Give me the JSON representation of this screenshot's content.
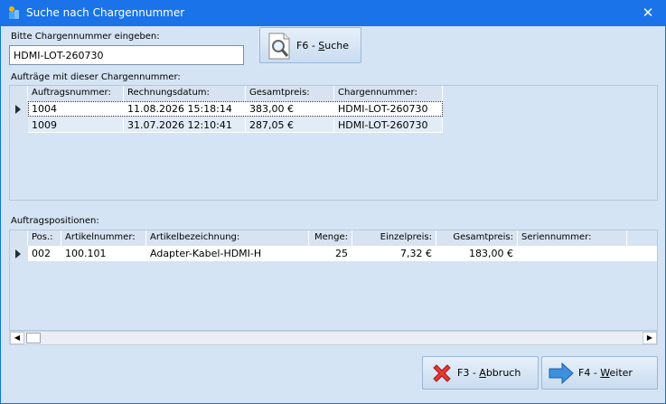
{
  "window": {
    "title": "Suche nach Chargennummer",
    "close_glyph": "✕"
  },
  "search": {
    "label": "Bitte Chargennummer eingeben:",
    "value": "HDMI-LOT-260730",
    "button_prefix": "F6 - ",
    "button_key": "S",
    "button_rest": "uche"
  },
  "orders": {
    "label": "Aufträge mit dieser Chargennummer:",
    "columns": [
      "Auftragsnummer:",
      "Rechnungsdatum:",
      "Gesamtpreis:",
      "Chargennummer:"
    ],
    "rows": [
      [
        "1004",
        "11.08.2026 15:18:14",
        "383,00 €",
        "HDMI-LOT-260730"
      ],
      [
        "1009",
        "31.07.2026 12:10:41",
        "287,05 €",
        "HDMI-LOT-260730"
      ]
    ]
  },
  "positions": {
    "label": "Auftragspositionen:",
    "columns": [
      "Pos.:",
      "Artikelnummer:",
      "Artikelbezeichnung:",
      "Menge:",
      "Einzelpreis:",
      "Gesamtpreis:",
      "Seriennummer:"
    ],
    "rows": [
      [
        "002",
        "100.101",
        "Adapter-Kabel-HDMI-H",
        "25",
        "7,32 €",
        "183,00 €",
        ""
      ]
    ]
  },
  "footer": {
    "cancel_prefix": "F3 - ",
    "cancel_key": "A",
    "cancel_rest": "bbruch",
    "next_prefix": "F4 - ",
    "next_key": "W",
    "next_rest": "eiter"
  },
  "icons": {
    "app": "app-icon",
    "search": "magnifier-document-icon",
    "cancel": "red-x-icon",
    "next": "blue-arrow-right-icon"
  }
}
